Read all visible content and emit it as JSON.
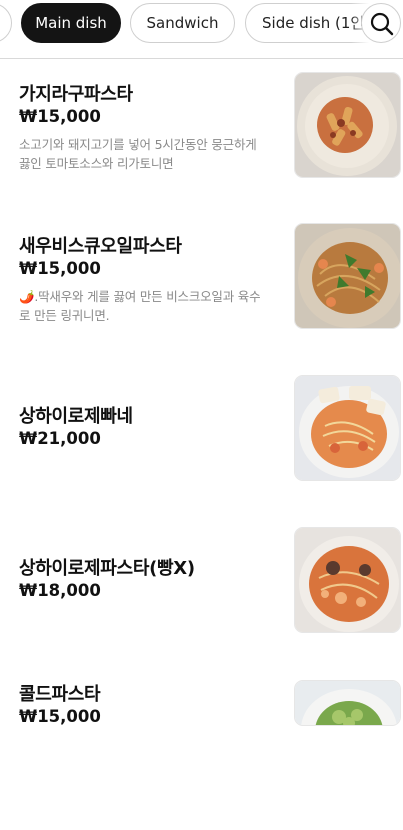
{
  "category_tabs": [
    {
      "label": "",
      "active": false
    },
    {
      "label": "Main dish",
      "active": true
    },
    {
      "label": "Sandwich",
      "active": false
    },
    {
      "label": "Side dish (1인",
      "active": false
    }
  ],
  "search": {
    "icon": "search-icon"
  },
  "menu": [
    {
      "name": "가지라구파스타",
      "price": "₩15,000",
      "description": "소고기와 돼지고기를 넣어 5시간동안 뭉근하게 끓인 토마토소스와 리가토니면"
    },
    {
      "name": "새우비스큐오일파스타",
      "price": "₩15,000",
      "description": "🌶️.딱새우와 게를 끓여 만든 비스크오일과 육수로 만든 링귀니면."
    },
    {
      "name": "상하이로제빠네",
      "price": "₩21,000",
      "description": ""
    },
    {
      "name": "상하이로제파스타(빵X)",
      "price": "₩18,000",
      "description": ""
    },
    {
      "name": "콜드파스타",
      "price": "₩15,000",
      "description": ""
    }
  ],
  "colors": {
    "active_chip": "#141414",
    "divider": "#d9d9d9",
    "description": "#8a8a8a"
  }
}
